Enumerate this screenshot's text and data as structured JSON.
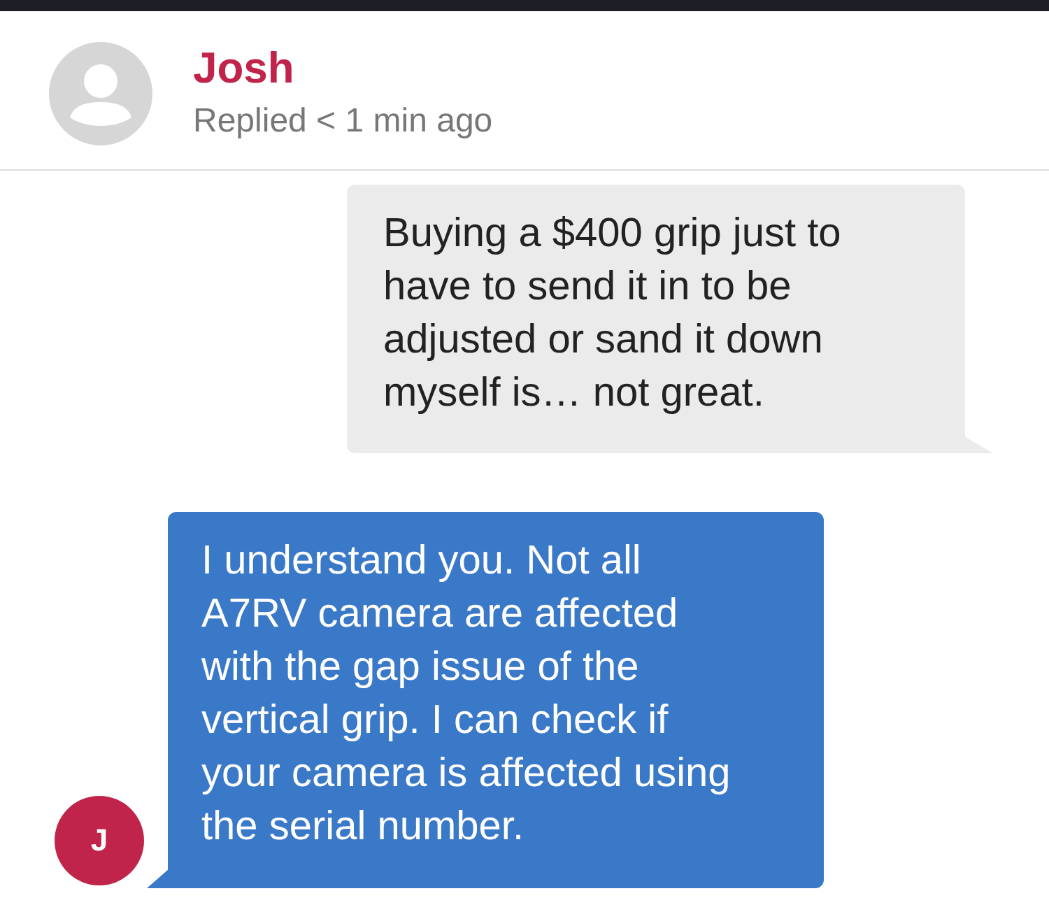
{
  "contact": {
    "name": "Josh",
    "status": "Replied < 1 min ago"
  },
  "messages": [
    {
      "kind": "outgoing",
      "text": "Buying a $400 grip just to have to send it in to be adjusted or sand it down myself is… not great."
    },
    {
      "kind": "incoming",
      "text": "I understand you. Not all A7RV camera are affected with the gap issue of the vertical grip. I can check if your camera is affected using the serial number.",
      "initial": "J"
    }
  ]
}
